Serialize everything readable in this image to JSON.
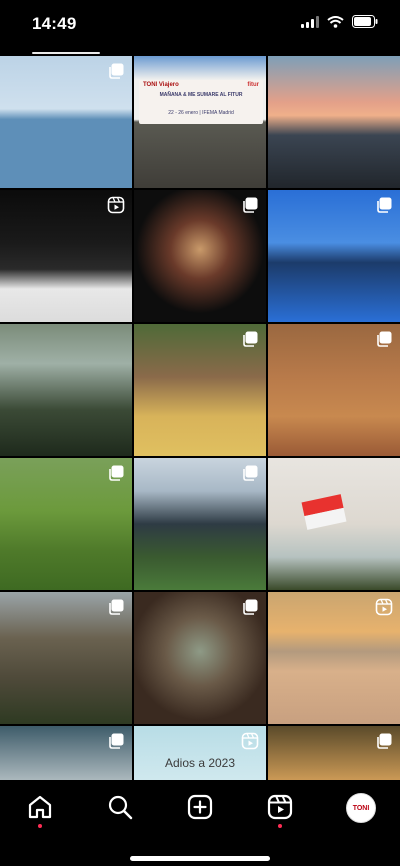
{
  "status_bar": {
    "time": "14:49"
  },
  "tiles": [
    {
      "bg": "linear-gradient(180deg,#bcd3e6 0%,#cfe0ee 40%,#5e8fb8 48%,#5e8fb8 100%)",
      "badge": "carousel"
    },
    {
      "bg": "linear-gradient(180deg,#6b9bd1 0%,#f0f0ee 18%,#f0f0ee 48%,#5a5a52 50%,#3f3d38 100%)",
      "badge": "none",
      "poster": true
    },
    {
      "bg": "linear-gradient(180deg,#7e9fb8 0%,#e3a089 35%,#f0b08a 45%,#3b4552 60%,#21262c 100%)",
      "badge": "none"
    },
    {
      "bg": "linear-gradient(180deg,#0b0b0b 0%,#1a1a1a 40%,#2a2a2a 60%,#e8e8e8 75%,#dcdcdc 100%)",
      "badge": "reel"
    },
    {
      "bg": "radial-gradient(circle at 50% 45%,#c99a6a 0%,#6a3a2a 30%,#0d0d0d 65%)",
      "badge": "carousel"
    },
    {
      "bg": "linear-gradient(180deg,#2a6fd6 0%,#4a8ee2 40%,#1c3b6a 55%,#2a6fd6 100%)",
      "badge": "carousel"
    },
    {
      "bg": "linear-gradient(180deg,#7b8c7a 0%,#9fb0a6 30%,#3b4a36 65%,#1e2a1c 100%)",
      "badge": "none"
    },
    {
      "bg": "linear-gradient(180deg,#4f6a38 0%,#8a6a4a 40%,#d8b35a 70%,#e0c060 100%)",
      "badge": "carousel"
    },
    {
      "bg": "linear-gradient(180deg,#9a6840 0%,#b87a4a 40%,#c8894f 70%,#9a5a36 100%)",
      "badge": "carousel"
    },
    {
      "bg": "linear-gradient(180deg,#7aa05a 0%,#6c9a3c 40%,#4f7a2a 70%,#3e6a22 100%)",
      "badge": "carousel"
    },
    {
      "bg": "linear-gradient(180deg,#c9d4de 0%,#a8b8c6 25%,#2e3b44 50%,#3a5a30 75%,#4a7a3a 100%)",
      "badge": "carousel"
    },
    {
      "bg": "linear-gradient(180deg,#e8e5e0 0%,#ddd8d0 50%,#b6c2c0 75%,#3a4a2a 100%)",
      "badge": "none",
      "flag": true
    },
    {
      "bg": "linear-gradient(180deg,#9aa4a8 0%,#6a6250 35%,#4f4a3a 65%,#2e3a22 100%)",
      "badge": "carousel"
    },
    {
      "bg": "radial-gradient(circle at 50% 45%,#8e9a86 0%,#6a5a48 35%,#3a2a20 70%)",
      "badge": "carousel"
    },
    {
      "bg": "linear-gradient(180deg,#caa570 0%,#e7b26d 30%,#b39a7e 45%,#d8b08a 60%,#c8a080 100%)",
      "badge": "reel"
    },
    {
      "bg": "linear-gradient(180deg,#3e5c6a 0%,#a9b6bb 40%,#e8dccf 70%,#f0e6de 100%)",
      "badge": "carousel"
    },
    {
      "bg": "linear-gradient(180deg,#b8dde6 0%,#cfe8ee 40%,#d8eef1 100%)",
      "badge": "reel",
      "adios": true
    },
    {
      "bg": "linear-gradient(180deg,#5a4a2a 0%,#d6a15a 45%,#7a3a2a 75%,#3a2a22 100%)",
      "badge": "carousel"
    }
  ],
  "poster_text": {
    "line1": "TONI Viajero",
    "logo": "fitur",
    "line2": "MAÑANA & ME SUMARE AL FITUR",
    "line3": "22 - 26 enero | IFEMA Madrid"
  },
  "adios_text": "Adios a 2023",
  "nav": {
    "items": [
      "home",
      "search",
      "create",
      "reels",
      "profile"
    ],
    "profile_label": "TONI"
  },
  "colors": {
    "notification_dot": "#ff2d55"
  }
}
